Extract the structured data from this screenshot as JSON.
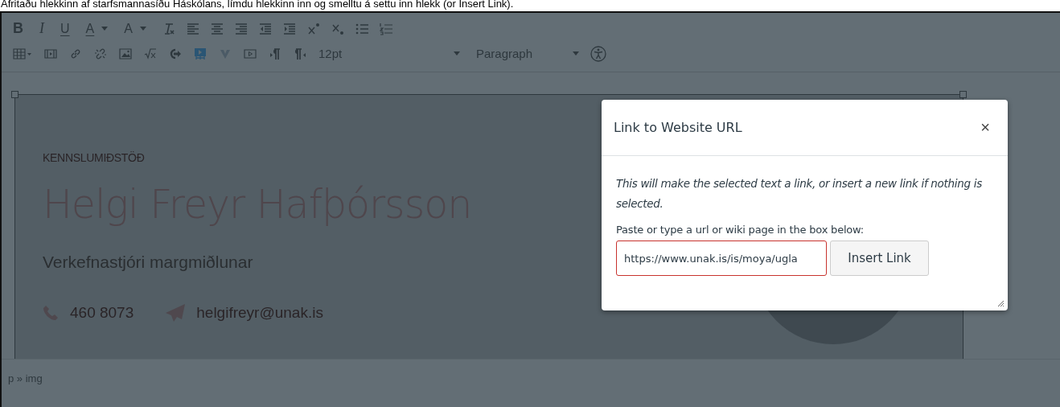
{
  "caption": "Afritaðu hlekkinn af starfsmannasíðu Háskólans, límdu hlekkinn inn og smelltu á settu inn hlekk (or Insert Link).",
  "toolbar": {
    "format_buttons": [
      {
        "kind": "bold",
        "label": "B",
        "dropdown": false
      },
      {
        "kind": "italic",
        "label": "I",
        "dropdown": false
      },
      {
        "kind": "underline",
        "label": "U",
        "dropdown": false
      },
      {
        "kind": "text-color",
        "label": "A",
        "dropdown": true
      },
      {
        "kind": "background-color",
        "label": "A",
        "dropdown": true
      }
    ],
    "font_size": "12pt",
    "block_format": "Paragraph"
  },
  "content": {
    "department": "KENNSLUMIÐSTÖÐ",
    "name": "Helgi Freyr Hafþórsson",
    "job_title": "Verkefnastjóri margmiðlunar",
    "phone": "460 8073",
    "email": "helgifreyr@unak.is"
  },
  "status_bar": {
    "path": "p » img"
  },
  "dialog": {
    "title": "Link to Website URL",
    "close": "×",
    "description": "This will make the selected text a link, or insert a new link if nothing is selected.",
    "field_label": "Paste or type a url or wiki page in the box below:",
    "url": {
      "value": "https://www.unak.is/is/moya/ugla",
      "invalid": true
    },
    "button": "Insert Link"
  }
}
